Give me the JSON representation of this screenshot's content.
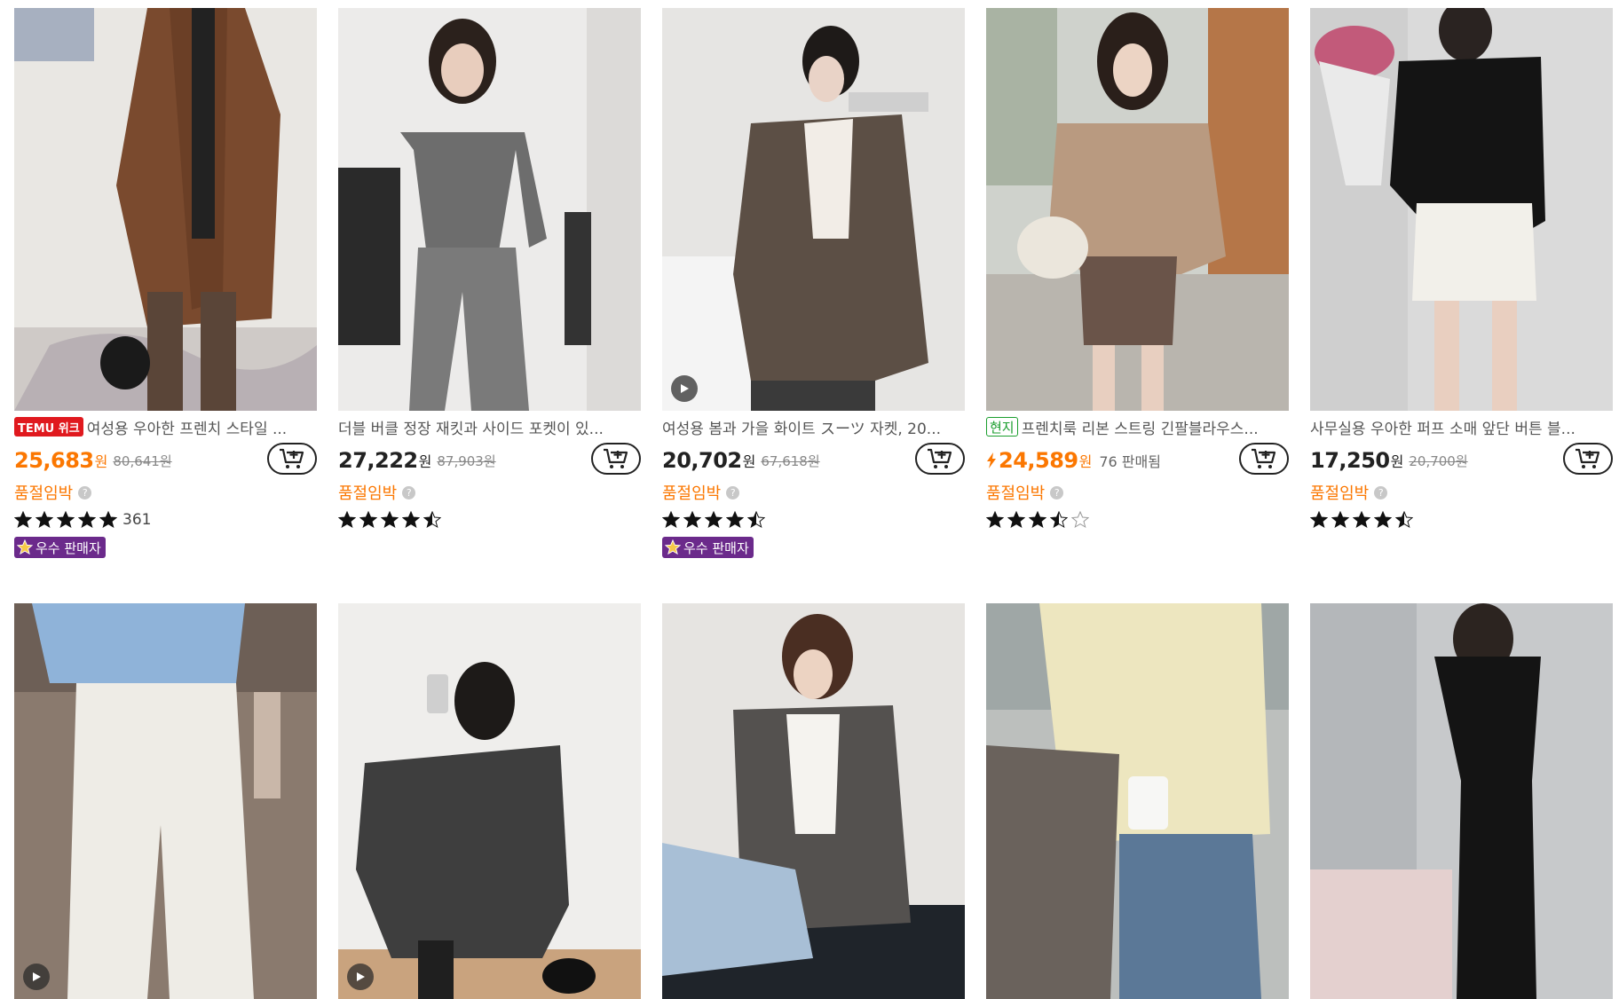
{
  "colors": {
    "accent_orange": "#fb7701",
    "temu_red": "#e0191e",
    "seller_purple": "#6b2a8b",
    "local_green": "#1a9e2d"
  },
  "products": [
    {
      "has_temu_badge": true,
      "temu_badge_text": "TEMU 위크",
      "title": "여성용 우아한 프렌치 스타일 ...",
      "price": "25,683",
      "currency": "원",
      "original_price": "80,641원",
      "stock_text": "품절임박",
      "rating": 5,
      "review_count": "361",
      "seller_badge": "우수 판매자",
      "has_video": false
    },
    {
      "title": "더블 버클 정장 재킷과 사이드 포켓이 있...",
      "price": "27,222",
      "currency": "원",
      "original_price": "87,903원",
      "stock_text": "품절임박",
      "rating": 4.5,
      "has_video": false
    },
    {
      "title": "여성용 봄과 가을 화이트 スーツ 자켓, 20...",
      "price": "20,702",
      "currency": "원",
      "original_price": "67,618원",
      "stock_text": "품절임박",
      "rating": 4.5,
      "seller_badge": "우수 판매자",
      "has_video": true
    },
    {
      "local_badge": "현지",
      "title": "프렌치룩 리본 스트링 긴팔블라우스...",
      "price": "24,589",
      "currency": "원",
      "sold_text": "76 판매됨",
      "flash_price": true,
      "stock_text": "품절임박",
      "rating": 3.5,
      "has_video": false
    },
    {
      "title": "사무실용 우아한 퍼프 소매 앞단 버튼 블...",
      "price": "17,250",
      "currency": "원",
      "original_price": "20,700원",
      "stock_text": "품절임박",
      "rating": 4.5,
      "has_video": false
    }
  ],
  "row2": [
    {
      "has_video": true
    },
    {
      "has_video": true
    },
    {
      "has_video": false
    },
    {
      "has_video": false
    },
    {
      "has_video": false
    }
  ],
  "icons": {
    "cart": "add-to-cart-icon",
    "help": "question-circle-icon",
    "star": "star-icon",
    "play": "play-icon",
    "bolt": "lightning-icon",
    "seller": "star-badge-icon"
  },
  "help_glyph": "?"
}
